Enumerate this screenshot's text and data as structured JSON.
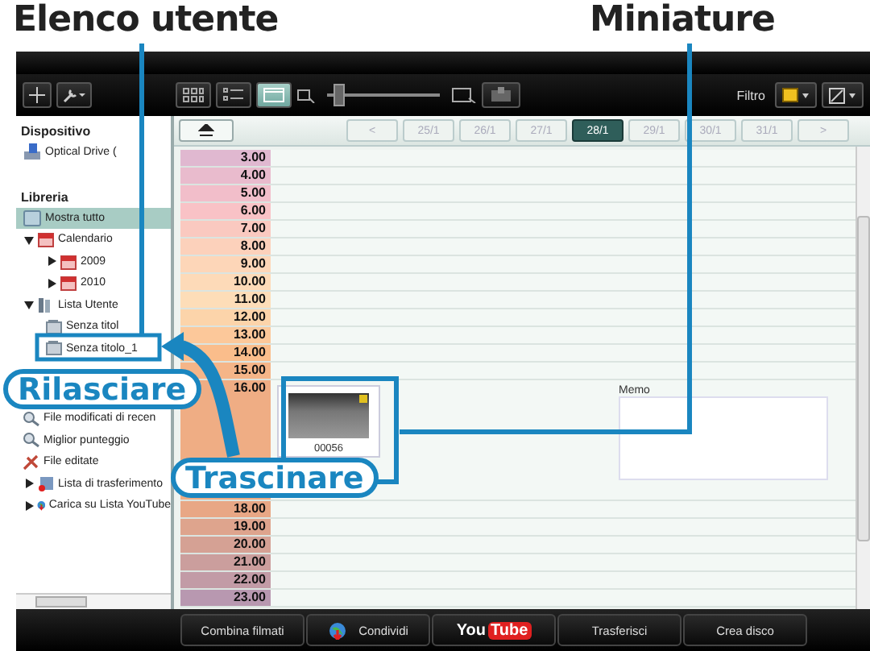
{
  "callouts": {
    "user_list": "Elenco utente",
    "thumbnail": "Miniature",
    "drop": "Rilasciare",
    "drag": "Trascinare"
  },
  "toolbar": {
    "views": [
      {
        "kind": "grid",
        "selected": false
      },
      {
        "kind": "list",
        "selected": false
      },
      {
        "kind": "calendar",
        "selected": true
      }
    ],
    "zoom": {
      "level": 0.1
    },
    "filter_label": "Filtro"
  },
  "sidebar": {
    "sections": [
      {
        "title": "Dispositivo",
        "items": [
          {
            "label": "Optical Drive (",
            "kind": "drive",
            "selected": false
          }
        ]
      },
      {
        "title": "Libreria",
        "items": [
          {
            "label": "Mostra tutto",
            "kind": "library",
            "selected": true
          },
          {
            "label": "Calendario",
            "kind": "calendar",
            "selected": false,
            "expanded": true,
            "children": [
              {
                "label": "2009",
                "kind": "calendar",
                "selected": false,
                "expanded": false
              },
              {
                "label": "2010",
                "kind": "calendar",
                "selected": false,
                "expanded": false
              }
            ]
          },
          {
            "label": "Lista Utente",
            "kind": "books",
            "selected": false,
            "expanded": true,
            "children": [
              {
                "label": "Senza titol",
                "kind": "list",
                "selected": false
              },
              {
                "label": "Senza titolo_1",
                "kind": "list",
                "selected": false
              }
            ]
          },
          {
            "label": "File modificati di recen",
            "kind": "search",
            "selected": false
          },
          {
            "label": "Miglior punteggio",
            "kind": "search",
            "selected": false
          },
          {
            "label": "File editate",
            "kind": "edit",
            "selected": false
          },
          {
            "label": "Lista di trasferimento",
            "kind": "transfer",
            "selected": false,
            "expanded": false
          },
          {
            "label": "Carica su Lista YouTube",
            "kind": "globe",
            "selected": false,
            "expanded": false
          }
        ]
      }
    ]
  },
  "date_nav": {
    "prev": "<",
    "next": ">",
    "dates": [
      {
        "label": "25/1",
        "selected": false
      },
      {
        "label": "26/1",
        "selected": false
      },
      {
        "label": "27/1",
        "selected": false
      },
      {
        "label": "28/1",
        "selected": true
      },
      {
        "label": "29/1",
        "selected": false
      },
      {
        "label": "30/1",
        "selected": false
      },
      {
        "label": "31/1",
        "selected": false
      }
    ]
  },
  "timeline": {
    "hours": [
      {
        "label": "3.00",
        "kind": "hour"
      },
      {
        "label": "4.00",
        "kind": "hour"
      },
      {
        "label": "5.00",
        "kind": "hour"
      },
      {
        "label": "6.00",
        "kind": "hour"
      },
      {
        "label": "7.00",
        "kind": "hour"
      },
      {
        "label": "8.00",
        "kind": "hour"
      },
      {
        "label": "9.00",
        "kind": "hour"
      },
      {
        "label": "10.00",
        "kind": "hour"
      },
      {
        "label": "11.00",
        "kind": "hour"
      },
      {
        "label": "12.00",
        "kind": "hour"
      },
      {
        "label": "13.00",
        "kind": "hour"
      },
      {
        "label": "14.00",
        "kind": "hour"
      },
      {
        "label": "15.00",
        "kind": "hour"
      },
      {
        "label": "16.00",
        "kind": "media"
      },
      {
        "label": "18.00",
        "kind": "hour"
      },
      {
        "label": "19.00",
        "kind": "hour"
      },
      {
        "label": "20.00",
        "kind": "hour"
      },
      {
        "label": "21.00",
        "kind": "hour"
      },
      {
        "label": "22.00",
        "kind": "hour"
      },
      {
        "label": "23.00",
        "kind": "hour"
      }
    ],
    "thumbnail": {
      "caption": "00056"
    },
    "memo": {
      "label": "Memo"
    }
  },
  "bottom_buttons": [
    {
      "kind": "text",
      "label": "Combina filmati"
    },
    {
      "kind": "globe",
      "label": "Condividi"
    },
    {
      "kind": "youtube",
      "label": "You",
      "label_2": "Tube"
    },
    {
      "kind": "text",
      "label": "Trasferisci"
    },
    {
      "kind": "text",
      "label": "Crea disco"
    }
  ]
}
